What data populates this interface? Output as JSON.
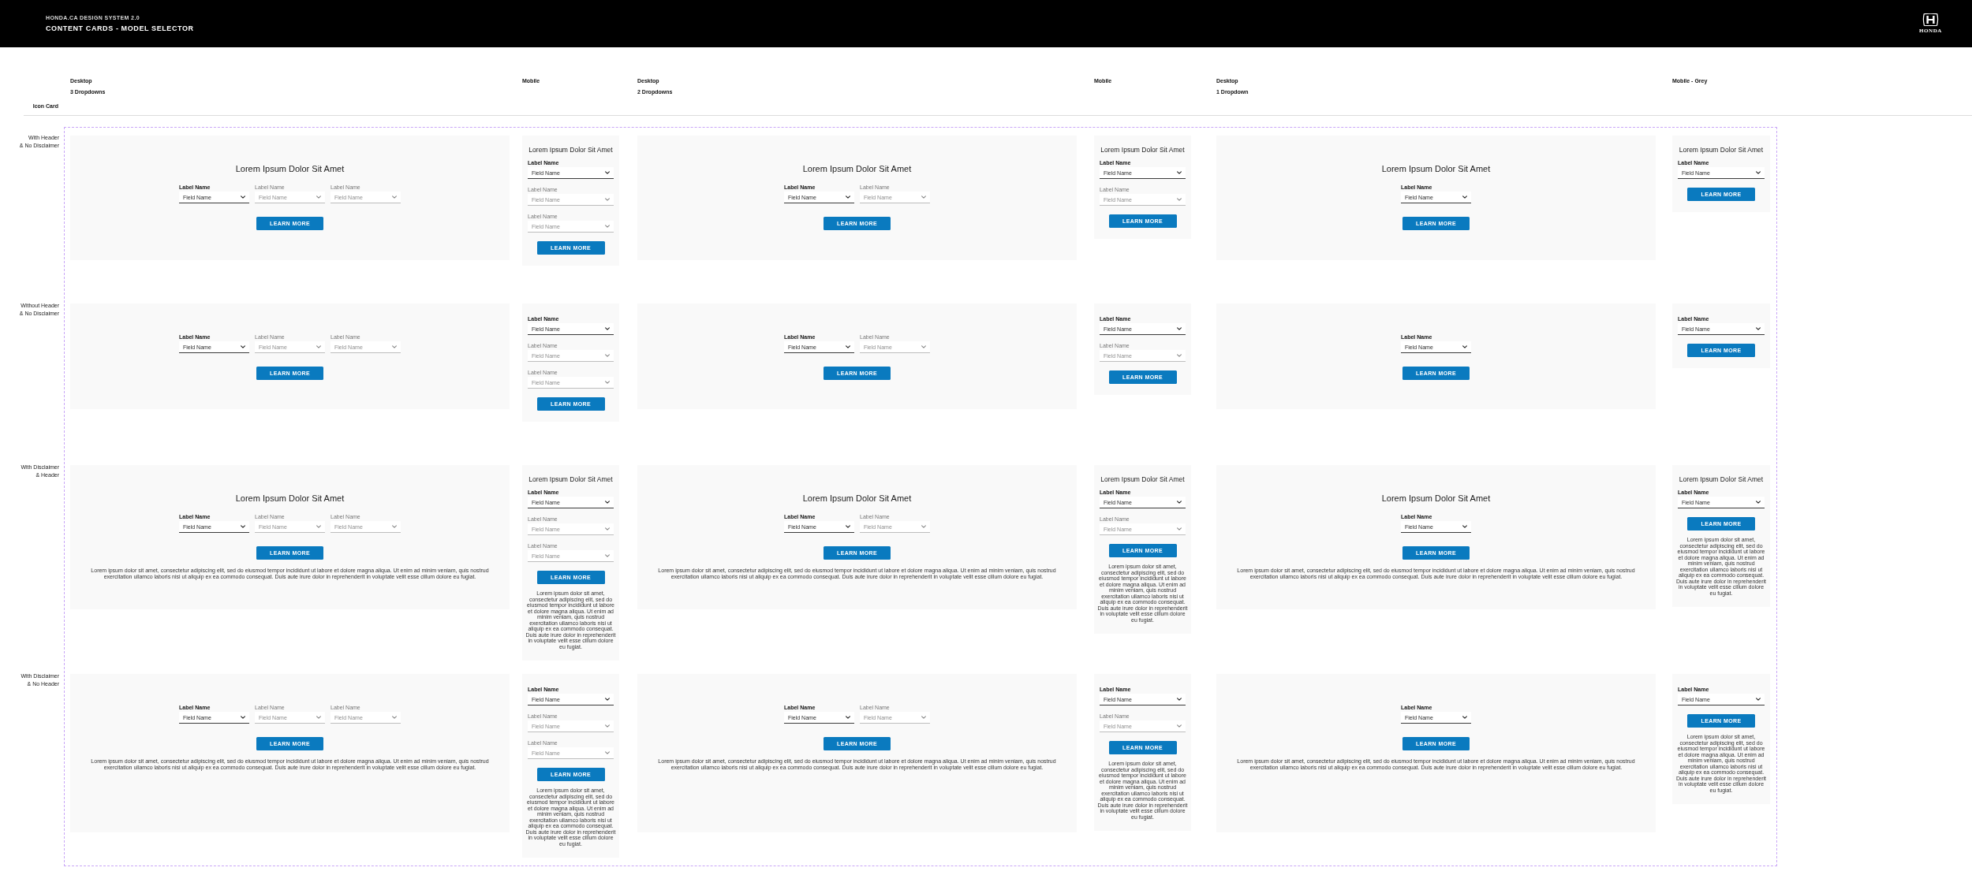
{
  "header": {
    "eyebrow": "HONDA.CA DESIGN SYSTEM 2.0",
    "title": "CONTENT CARDS - MODEL SELECTOR",
    "logo_text": "HONDA"
  },
  "board": {
    "corner_label": "Icon Card",
    "columns": [
      {
        "kind": "desktop",
        "title": "Desktop",
        "subtitle": "3 Dropdowns"
      },
      {
        "kind": "mobile",
        "title": "Mobile"
      },
      {
        "kind": "desktop",
        "title": "Desktop",
        "subtitle": "2 Dropdowns"
      },
      {
        "kind": "mobile",
        "title": "Mobile"
      },
      {
        "kind": "desktop",
        "title": "Desktop",
        "subtitle": "1 Dropdown"
      },
      {
        "kind": "mobile",
        "title": "Mobile - Grey"
      }
    ],
    "rows": [
      {
        "label_lines": [
          "With Header",
          "& No Disclaimer"
        ],
        "cards": [
          {
            "heading": "Lorem Ipsum Dolor Sit Amet",
            "dropdowns": [
              {
                "label": "Label Name",
                "value": "Field Name",
                "disabled": false
              },
              {
                "label": "Label Name",
                "value": "Field Name",
                "disabled": true
              },
              {
                "label": "Label Name",
                "value": "Field Name",
                "disabled": true
              }
            ],
            "button": "LEARN MORE"
          },
          {
            "heading": "Lorem Ipsum Dolor Sit Amet",
            "dropdowns": [
              {
                "label": "Label Name",
                "value": "Field Name",
                "disabled": false
              },
              {
                "label": "Label Name",
                "value": "Field Name",
                "disabled": true
              },
              {
                "label": "Label Name",
                "value": "Field Name",
                "disabled": true
              }
            ],
            "button": "LEARN MORE"
          },
          {
            "heading": "Lorem Ipsum Dolor Sit Amet",
            "dropdowns": [
              {
                "label": "Label Name",
                "value": "Field Name",
                "disabled": false
              },
              {
                "label": "Label Name",
                "value": "Field Name",
                "disabled": true
              }
            ],
            "button": "LEARN MORE"
          },
          {
            "heading": "Lorem Ipsum Dolor Sit Amet",
            "dropdowns": [
              {
                "label": "Label Name",
                "value": "Field Name",
                "disabled": false
              },
              {
                "label": "Label Name",
                "value": "Field Name",
                "disabled": true
              }
            ],
            "button": "LEARN MORE"
          },
          {
            "heading": "Lorem Ipsum Dolor Sit Amet",
            "dropdowns": [
              {
                "label": "Label Name",
                "value": "Field Name",
                "disabled": false
              }
            ],
            "button": "LEARN MORE"
          },
          {
            "heading": "Lorem Ipsum Dolor Sit Amet",
            "dropdowns": [
              {
                "label": "Label Name",
                "value": "Field Name",
                "disabled": false
              }
            ],
            "button": "LEARN MORE"
          }
        ]
      },
      {
        "label_lines": [
          "Without Header",
          "& No Disclaimer"
        ],
        "cards": [
          {
            "dropdowns": [
              {
                "label": "Label Name",
                "value": "Field Name",
                "disabled": false
              },
              {
                "label": "Label Name",
                "value": "Field Name",
                "disabled": true
              },
              {
                "label": "Label Name",
                "value": "Field Name",
                "disabled": true
              }
            ],
            "button": "LEARN MORE"
          },
          {
            "dropdowns": [
              {
                "label": "Label Name",
                "value": "Field Name",
                "disabled": false
              },
              {
                "label": "Label Name",
                "value": "Field Name",
                "disabled": true
              },
              {
                "label": "Label Name",
                "value": "Field Name",
                "disabled": true
              }
            ],
            "button": "LEARN MORE"
          },
          {
            "dropdowns": [
              {
                "label": "Label Name",
                "value": "Field Name",
                "disabled": false
              },
              {
                "label": "Label Name",
                "value": "Field Name",
                "disabled": true
              }
            ],
            "button": "LEARN MORE"
          },
          {
            "dropdowns": [
              {
                "label": "Label Name",
                "value": "Field Name",
                "disabled": false
              },
              {
                "label": "Label Name",
                "value": "Field Name",
                "disabled": true
              }
            ],
            "button": "LEARN MORE"
          },
          {
            "dropdowns": [
              {
                "label": "Label Name",
                "value": "Field Name",
                "disabled": false
              }
            ],
            "button": "LEARN MORE"
          },
          {
            "dropdowns": [
              {
                "label": "Label Name",
                "value": "Field Name",
                "disabled": false
              }
            ],
            "button": "LEARN MORE"
          }
        ]
      },
      {
        "label_lines": [
          "With Disclaimer",
          "& Header"
        ],
        "cards": [
          {
            "heading": "Lorem Ipsum Dolor Sit Amet",
            "dropdowns": [
              {
                "label": "Label Name",
                "value": "Field Name",
                "disabled": false
              },
              {
                "label": "Label Name",
                "value": "Field Name",
                "disabled": true
              },
              {
                "label": "Label Name",
                "value": "Field Name",
                "disabled": true
              }
            ],
            "button": "LEARN MORE",
            "disclaimer": "Lorem ipsum dolor sit amet, consectetur adipiscing elit, sed do eiusmod tempor incididunt ut labore et dolore magna aliqua. Ut enim ad minim veniam, quis nostrud exercitation ullamco laboris nisi ut aliquip ex ea commodo consequat. Duis aute irure dolor in reprehenderit in voluptate velit esse cillum dolore eu fugiat."
          },
          {
            "heading": "Lorem Ipsum Dolor Sit Amet",
            "dropdowns": [
              {
                "label": "Label Name",
                "value": "Field Name",
                "disabled": false
              },
              {
                "label": "Label Name",
                "value": "Field Name",
                "disabled": true
              },
              {
                "label": "Label Name",
                "value": "Field Name",
                "disabled": true
              }
            ],
            "button": "LEARN MORE",
            "disclaimer": "Lorem ipsum dolor sit amet, consectetur adipiscing elit, sed do eiusmod tempor incididunt ut labore et dolore magna aliqua. Ut enim ad minim veniam, quis nostrud exercitation ullamco laboris nisi ut aliquip ex ea commodo consequat. Duis aute irure dolor in reprehenderit in voluptate velit esse cillum dolore eu fugiat."
          },
          {
            "heading": "Lorem Ipsum Dolor Sit Amet",
            "dropdowns": [
              {
                "label": "Label Name",
                "value": "Field Name",
                "disabled": false
              },
              {
                "label": "Label Name",
                "value": "Field Name",
                "disabled": true
              }
            ],
            "button": "LEARN MORE",
            "disclaimer": "Lorem ipsum dolor sit amet, consectetur adipiscing elit, sed do eiusmod tempor incididunt ut labore et dolore magna aliqua. Ut enim ad minim veniam, quis nostrud exercitation ullamco laboris nisi ut aliquip ex ea commodo consequat. Duis aute irure dolor in reprehenderit in voluptate velit esse cillum dolore eu fugiat."
          },
          {
            "heading": "Lorem Ipsum Dolor Sit Amet",
            "dropdowns": [
              {
                "label": "Label Name",
                "value": "Field Name",
                "disabled": false
              },
              {
                "label": "Label Name",
                "value": "Field Name",
                "disabled": true
              }
            ],
            "button": "LEARN MORE",
            "disclaimer": "Lorem ipsum dolor sit amet, consectetur adipiscing elit, sed do eiusmod tempor incididunt ut labore et dolore magna aliqua. Ut enim ad minim veniam, quis nostrud exercitation ullamco laboris nisi ut aliquip ex ea commodo consequat. Duis aute irure dolor in reprehenderit in voluptate velit esse cillum dolore eu fugiat."
          },
          {
            "heading": "Lorem Ipsum Dolor Sit Amet",
            "dropdowns": [
              {
                "label": "Label Name",
                "value": "Field Name",
                "disabled": false
              }
            ],
            "button": "LEARN MORE",
            "disclaimer": "Lorem ipsum dolor sit amet, consectetur adipiscing elit, sed do eiusmod tempor incididunt ut labore et dolore magna aliqua. Ut enim ad minim veniam, quis nostrud exercitation ullamco laboris nisi ut aliquip ex ea commodo consequat. Duis aute irure dolor in reprehenderit in voluptate velit esse cillum dolore eu fugiat."
          },
          {
            "heading": "Lorem Ipsum Dolor Sit Amet",
            "dropdowns": [
              {
                "label": "Label Name",
                "value": "Field Name",
                "disabled": false
              }
            ],
            "button": "LEARN MORE",
            "disclaimer": "Lorem ipsum dolor sit amet, consectetur adipiscing elit, sed do eiusmod tempor incididunt ut labore et dolore magna aliqua. Ut enim ad minim veniam, quis nostrud exercitation ullamco laboris nisi ut aliquip ex ea commodo consequat. Duis aute irure dolor in reprehenderit in voluptate velit esse cillum dolore eu fugiat."
          }
        ]
      },
      {
        "label_lines": [
          "With Disclaimer",
          "& No Header"
        ],
        "cards": [
          {
            "dropdowns": [
              {
                "label": "Label Name",
                "value": "Field Name",
                "disabled": false
              },
              {
                "label": "Label Name",
                "value": "Field Name",
                "disabled": true
              },
              {
                "label": "Label Name",
                "value": "Field Name",
                "disabled": true
              }
            ],
            "button": "LEARN MORE",
            "disclaimer": "Lorem ipsum dolor sit amet, consectetur adipiscing elit, sed do eiusmod tempor incididunt ut labore et dolore magna aliqua. Ut enim ad minim veniam, quis nostrud exercitation ullamco laboris nisi ut aliquip ex ea commodo consequat. Duis aute irure dolor in reprehenderit in voluptate velit esse cillum dolore eu fugiat."
          },
          {
            "dropdowns": [
              {
                "label": "Label Name",
                "value": "Field Name",
                "disabled": false
              },
              {
                "label": "Label Name",
                "value": "Field Name",
                "disabled": true
              },
              {
                "label": "Label Name",
                "value": "Field Name",
                "disabled": true
              }
            ],
            "button": "LEARN MORE",
            "disclaimer": "Lorem ipsum dolor sit amet, consectetur adipiscing elit, sed do eiusmod tempor incididunt ut labore et dolore magna aliqua. Ut enim ad minim veniam, quis nostrud exercitation ullamco laboris nisi ut aliquip ex ea commodo consequat. Duis aute irure dolor in reprehenderit in voluptate velit esse cillum dolore eu fugiat."
          },
          {
            "dropdowns": [
              {
                "label": "Label Name",
                "value": "Field Name",
                "disabled": false
              },
              {
                "label": "Label Name",
                "value": "Field Name",
                "disabled": true
              }
            ],
            "button": "LEARN MORE",
            "disclaimer": "Lorem ipsum dolor sit amet, consectetur adipiscing elit, sed do eiusmod tempor incididunt ut labore et dolore magna aliqua. Ut enim ad minim veniam, quis nostrud exercitation ullamco laboris nisi ut aliquip ex ea commodo consequat. Duis aute irure dolor in reprehenderit in voluptate velit esse cillum dolore eu fugiat."
          },
          {
            "dropdowns": [
              {
                "label": "Label Name",
                "value": "Field Name",
                "disabled": false
              },
              {
                "label": "Label Name",
                "value": "Field Name",
                "disabled": true
              }
            ],
            "button": "LEARN MORE",
            "disclaimer": "Lorem ipsum dolor sit amet, consectetur adipiscing elit, sed do eiusmod tempor incididunt ut labore et dolore magna aliqua. Ut enim ad minim veniam, quis nostrud exercitation ullamco laboris nisi ut aliquip ex ea commodo consequat. Duis aute irure dolor in reprehenderit in voluptate velit esse cillum dolore eu fugiat."
          },
          {
            "dropdowns": [
              {
                "label": "Label Name",
                "value": "Field Name",
                "disabled": false
              }
            ],
            "button": "LEARN MORE",
            "disclaimer": "Lorem ipsum dolor sit amet, consectetur adipiscing elit, sed do eiusmod tempor incididunt ut labore et dolore magna aliqua. Ut enim ad minim veniam, quis nostrud exercitation ullamco laboris nisi ut aliquip ex ea commodo consequat. Duis aute irure dolor in reprehenderit in voluptate velit esse cillum dolore eu fugiat."
          },
          {
            "dropdowns": [
              {
                "label": "Label Name",
                "value": "Field Name",
                "disabled": false
              }
            ],
            "button": "LEARN MORE",
            "disclaimer": "Lorem ipsum dolor sit amet, consectetur adipiscing elit, sed do eiusmod tempor incididunt ut labore et dolore magna aliqua. Ut enim ad minim veniam, quis nostrud exercitation ullamco laboris nisi ut aliquip ex ea commodo consequat. Duis aute irure dolor in reprehenderit in voluptate velit esse cillum dolore eu fugiat."
          }
        ]
      }
    ]
  }
}
